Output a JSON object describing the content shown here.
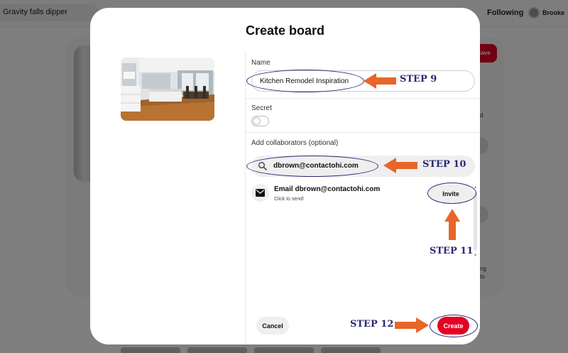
{
  "background": {
    "search_text": "Gravity falls dipper",
    "following_label": "Following",
    "user_name": "Brooke",
    "save_label": "Save",
    "side_text_1": "d",
    "side_text_2": "ng",
    "side_text_3": "to"
  },
  "modal": {
    "title": "Create board",
    "name_label": "Name",
    "name_value": "Kitchen Remodel Inspiration",
    "secret_label": "Secret",
    "secret_on": false,
    "collaborators_label": "Add collaborators (optional)",
    "collaborators_value": "dbrown@contactohi.com",
    "result": {
      "title": "Email dbrown@contactohi.com",
      "subtitle": "Click to send!",
      "invite_label": "Invite"
    },
    "cancel_label": "Cancel",
    "create_label": "Create"
  },
  "annotations": {
    "step9": "STEP 9",
    "step10": "STEP 10",
    "step11": "STEP 11",
    "step12": "STEP 12",
    "ellipse_color": "#2b2873",
    "arrow_color": "#e8662a"
  },
  "colors": {
    "accent": "#e60023",
    "label_ink": "#2b2873"
  }
}
